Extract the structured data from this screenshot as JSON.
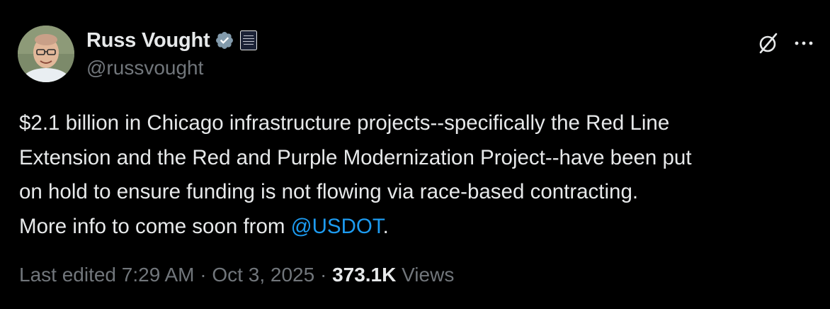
{
  "author": {
    "display_name": "Russ Vought",
    "handle": "@russvought"
  },
  "tweet": {
    "text_before": "$2.1 billion in Chicago infrastructure projects--specifically the Red Line\nExtension and the Red and Purple Modernization Project--have been put\non hold to ensure funding is not flowing via race-based contracting.\nMore info to come soon from ",
    "mention": "@USDOT",
    "text_after": "."
  },
  "meta": {
    "edited_label": "Last edited 7:29 AM",
    "separator_1": " · ",
    "date": "Oct 3, 2025",
    "separator_2": " · ",
    "views_count": "373.1K",
    "views_label": " Views"
  },
  "icons": {
    "verified": "verified-badge-icon",
    "affiliation": "white-house-badge-icon",
    "grok": "grok-icon",
    "more": "more-options-icon"
  },
  "colors": {
    "background": "#000000",
    "text_primary": "#e7e9ea",
    "text_secondary": "#71767b",
    "accent": "#1d9bf0",
    "verified_badge": "#829aab"
  }
}
